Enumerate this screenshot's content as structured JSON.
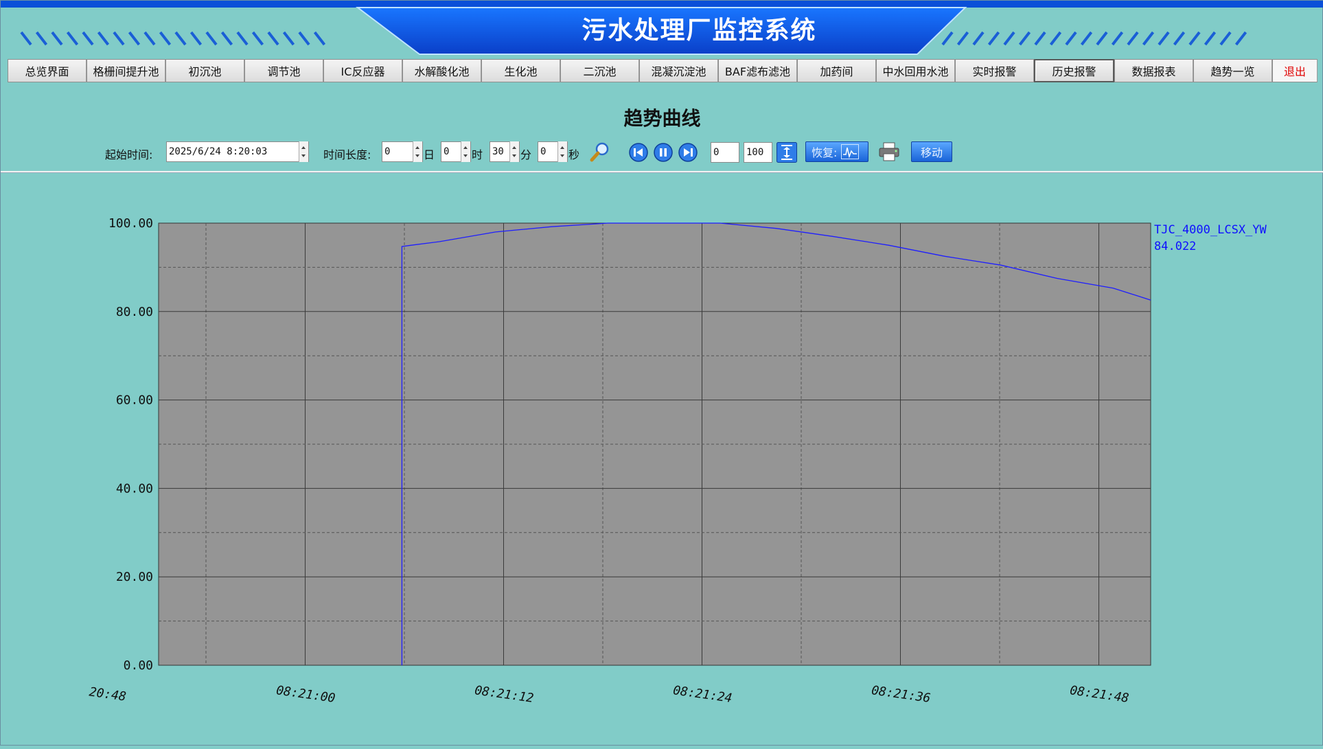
{
  "header": {
    "title": "污水处理厂监控系统"
  },
  "nav": {
    "items": [
      "总览界面",
      "格栅间提升池",
      "初沉池",
      "调节池",
      "IC反应器",
      "水解酸化池",
      "生化池",
      "二沉池",
      "混凝沉淀池",
      "BAF滤布滤池",
      "加药间",
      "中水回用水池",
      "实时报警",
      "历史报警",
      "数据报表",
      "趋势一览"
    ],
    "active_index": 13,
    "exit_label": "退出"
  },
  "page_title": "趋势曲线",
  "toolbar": {
    "start_label": "起始时间:",
    "start_value": "2025/6/24 8:20:03",
    "duration_label": "时间长度:",
    "day_value": "0",
    "day_unit": "日",
    "hour_value": "0",
    "hour_unit": "时",
    "minute_value": "30",
    "minute_unit": "分",
    "second_value": "0",
    "second_unit": "秒",
    "range_min": "0",
    "range_max": "100",
    "restore_label": "恢复:",
    "move_label": "移动",
    "icons": [
      "search-icon",
      "skip-back-icon",
      "pause-icon",
      "skip-forward-icon",
      "fit-range-icon",
      "restore-chart-icon",
      "print-icon"
    ]
  },
  "colors": {
    "plot_bg": "#959595",
    "series": "#1e1eff",
    "page_bg": "#81ccc8",
    "header_blue": "#0a4fd8"
  },
  "chart_data": {
    "type": "line",
    "x_tick_labels": [
      "20:48",
      "08:21:00",
      "08:21:12",
      "08:21:24",
      "08:21:36",
      "08:21:48"
    ],
    "ylim": [
      0,
      100
    ],
    "y_tick_labels": [
      "100.00",
      "80.00",
      "60.00",
      "40.00",
      "20.00",
      "0.00"
    ],
    "grid": true,
    "legend_placement": "right",
    "series": [
      {
        "name": "TJC_4000_LCSX_YW",
        "current_value": "84.022",
        "x_seconds": [
          0,
          13,
          13,
          13.5,
          15,
          18,
          21,
          24,
          27,
          30,
          33,
          36,
          39,
          42,
          45,
          48,
          51,
          53
        ],
        "values": [
          null,
          0,
          94.7,
          95,
          95.8,
          98,
          99.2,
          100,
          100,
          100,
          98.8,
          97,
          95,
          92.5,
          90.5,
          87.5,
          85.3,
          82.6
        ]
      }
    ]
  }
}
